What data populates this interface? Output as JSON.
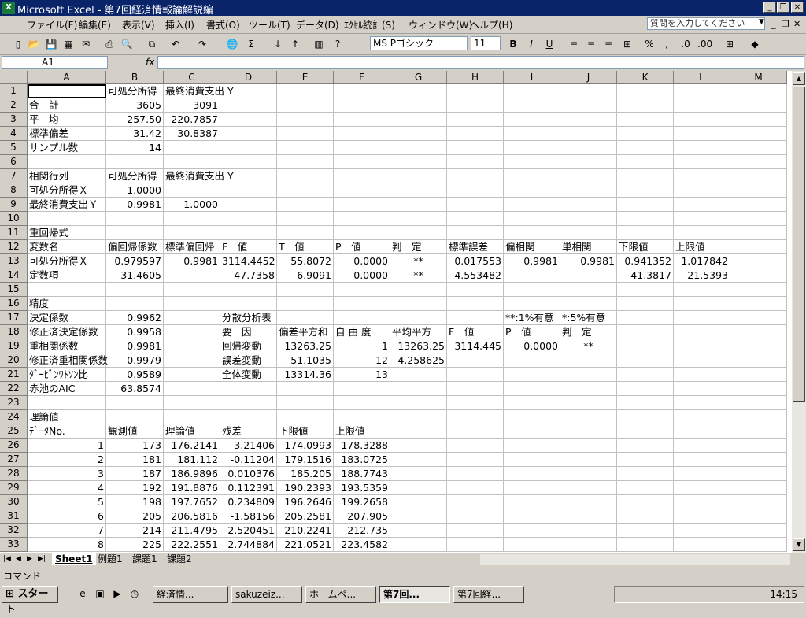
{
  "window": {
    "title": "Microsoft Excel - 第7回経済情報論解説編"
  },
  "menu": [
    "ファイル(F)",
    "編集(E)",
    "表示(V)",
    "挿入(I)",
    "書式(O)",
    "ツール(T)",
    "データ(D)",
    "ｴｸｾﾙ統計(S)",
    "ウィンドウ(W)",
    "ヘルプ(H)"
  ],
  "help_placeholder": "質問を入力してください",
  "toolbar": {
    "font": "MS Pゴシック",
    "size": "11",
    "bold": "B",
    "italic": "I",
    "underline": "U",
    "percent": "%",
    "comma": ",",
    "sigma": "Σ"
  },
  "formula": {
    "name_box": "A1",
    "fx": "fx",
    "value": ""
  },
  "columns": [
    "A",
    "B",
    "C",
    "D",
    "E",
    "F",
    "G",
    "H",
    "I",
    "J",
    "K",
    "L",
    "M"
  ],
  "rows": [
    [
      "",
      "可処分所得",
      "最終消費支出 Y",
      "",
      "",
      "",
      "",
      "",
      "",
      "",
      "",
      "",
      ""
    ],
    [
      "合　計",
      "3605",
      "3091",
      "",
      "",
      "",
      "",
      "",
      "",
      "",
      "",
      "",
      ""
    ],
    [
      "平　均",
      "257.50",
      "220.7857",
      "",
      "",
      "",
      "",
      "",
      "",
      "",
      "",
      "",
      ""
    ],
    [
      "標準偏差",
      "31.42",
      "30.8387",
      "",
      "",
      "",
      "",
      "",
      "",
      "",
      "",
      "",
      ""
    ],
    [
      "サンプル数",
      "14",
      "",
      "",
      "",
      "",
      "",
      "",
      "",
      "",
      "",
      "",
      ""
    ],
    [
      "",
      "",
      "",
      "",
      "",
      "",
      "",
      "",
      "",
      "",
      "",
      "",
      ""
    ],
    [
      "相関行列",
      "可処分所得",
      "最終消費支出 Y",
      "",
      "",
      "",
      "",
      "",
      "",
      "",
      "",
      "",
      ""
    ],
    [
      "可処分所得Ｘ",
      "1.0000",
      "",
      "",
      "",
      "",
      "",
      "",
      "",
      "",
      "",
      "",
      ""
    ],
    [
      "最終消費支出Ｙ",
      "0.9981",
      "1.0000",
      "",
      "",
      "",
      "",
      "",
      "",
      "",
      "",
      "",
      ""
    ],
    [
      "",
      "",
      "",
      "",
      "",
      "",
      "",
      "",
      "",
      "",
      "",
      "",
      ""
    ],
    [
      "重回帰式",
      "",
      "",
      "",
      "",
      "",
      "",
      "",
      "",
      "",
      "",
      "",
      ""
    ],
    [
      "変数名",
      "偏回帰係数",
      "標準偏回帰",
      "F　値",
      "T　値",
      "P　値",
      "判　定",
      "標準誤差",
      "偏相関",
      "単相関",
      "下限値",
      "上限値",
      ""
    ],
    [
      "可処分所得Ｘ",
      "0.979597",
      "0.9981",
      "3114.4452",
      "55.8072",
      "0.0000",
      "**",
      "0.017553",
      "0.9981",
      "0.9981",
      "0.941352",
      "1.017842",
      ""
    ],
    [
      "定数項",
      "-31.4605",
      "",
      "47.7358",
      "6.9091",
      "0.0000",
      "**",
      "4.553482",
      "",
      "",
      "-41.3817",
      "-21.5393",
      ""
    ],
    [
      "",
      "",
      "",
      "",
      "",
      "",
      "",
      "",
      "",
      "",
      "",
      "",
      ""
    ],
    [
      "精度",
      "",
      "",
      "",
      "",
      "",
      "",
      "",
      "",
      "",
      "",
      "",
      ""
    ],
    [
      "決定係数",
      "0.9962",
      "",
      "分散分析表",
      "",
      "",
      "",
      "",
      "**:1%有意",
      "*:5%有意",
      "",
      "",
      ""
    ],
    [
      "修正済決定係数",
      "0.9958",
      "",
      "要　因",
      "偏差平方和",
      "自 由 度",
      "平均平方",
      "F　値",
      "P　値",
      "判　定",
      "",
      "",
      ""
    ],
    [
      "重相関係数",
      "0.9981",
      "",
      "回帰変動",
      "13263.25",
      "1",
      "13263.25",
      "3114.445",
      "0.0000",
      "**",
      "",
      "",
      ""
    ],
    [
      "修正済重相関係数",
      "0.9979",
      "",
      "誤差変動",
      "51.1035",
      "12",
      "4.258625",
      "",
      "",
      "",
      "",
      "",
      ""
    ],
    [
      "ﾀﾞｰﾋﾞﾝﾜﾄｿﾝ比",
      "0.9589",
      "",
      "全体変動",
      "13314.36",
      "13",
      "",
      "",
      "",
      "",
      "",
      "",
      ""
    ],
    [
      "赤池のAIC",
      "63.8574",
      "",
      "",
      "",
      "",
      "",
      "",
      "",
      "",
      "",
      "",
      ""
    ],
    [
      "",
      "",
      "",
      "",
      "",
      "",
      "",
      "",
      "",
      "",
      "",
      "",
      ""
    ],
    [
      "理論値",
      "",
      "",
      "",
      "",
      "",
      "",
      "",
      "",
      "",
      "",
      "",
      ""
    ],
    [
      "ﾃﾞｰﾀNo.",
      "観測値",
      "理論値",
      "残差",
      "下限値",
      "上限値",
      "",
      "",
      "",
      "",
      "",
      "",
      ""
    ],
    [
      "1",
      "173",
      "176.2141",
      "-3.21406",
      "174.0993",
      "178.3288",
      "",
      "",
      "",
      "",
      "",
      "",
      ""
    ],
    [
      "2",
      "181",
      "181.112",
      "-0.11204",
      "179.1516",
      "183.0725",
      "",
      "",
      "",
      "",
      "",
      "",
      ""
    ],
    [
      "3",
      "187",
      "186.9896",
      "0.010376",
      "185.205",
      "188.7743",
      "",
      "",
      "",
      "",
      "",
      "",
      ""
    ],
    [
      "4",
      "192",
      "191.8876",
      "0.112391",
      "190.2393",
      "193.5359",
      "",
      "",
      "",
      "",
      "",
      "",
      ""
    ],
    [
      "5",
      "198",
      "197.7652",
      "0.234809",
      "196.2646",
      "199.2658",
      "",
      "",
      "",
      "",
      "",
      "",
      ""
    ],
    [
      "6",
      "205",
      "206.5816",
      "-1.58156",
      "205.2581",
      "207.905",
      "",
      "",
      "",
      "",
      "",
      "",
      ""
    ],
    [
      "7",
      "214",
      "211.4795",
      "2.520451",
      "210.2241",
      "212.735",
      "",
      "",
      "",
      "",
      "",
      "",
      ""
    ],
    [
      "8",
      "225",
      "222.2551",
      "2.744884",
      "221.0521",
      "223.4582",
      "",
      "",
      "",
      "",
      "",
      "",
      ""
    ]
  ],
  "sheets": [
    "Sheet1",
    "例題1",
    "課題1",
    "課題2"
  ],
  "status": "コマンド",
  "taskbar": {
    "start": "スタート",
    "buttons": [
      "経済情...",
      "sakuzeiz...",
      "ホームペ...",
      "第7回...",
      "第7回経..."
    ],
    "clock": "14:15"
  }
}
